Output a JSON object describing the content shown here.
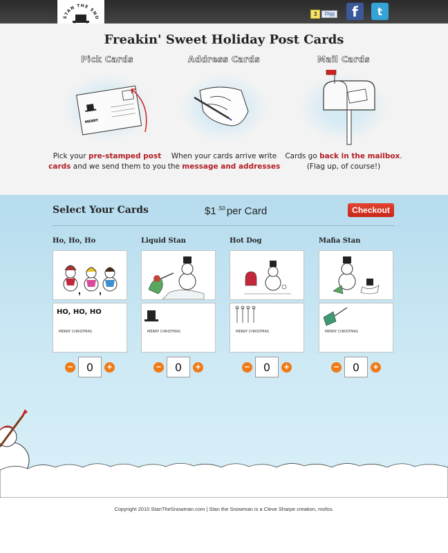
{
  "header": {
    "logo_text": "STAN THE SNOWMAN",
    "digg": {
      "count": "3",
      "label": "Digg"
    },
    "social": [
      {
        "name": "facebook",
        "glyph": "f",
        "color": "#3b5998"
      },
      {
        "name": "twitter",
        "glyph": "t",
        "color": "#33a3d8"
      }
    ]
  },
  "how": {
    "title": "Freakin' Sweet Holiday Post Cards",
    "steps": [
      {
        "heading": "Pick Cards",
        "text_pre": "Pick your ",
        "text_hl": "pre-stamped post cards",
        "text_post": " and we send them to you"
      },
      {
        "heading": "Address Cards",
        "text_pre": "When your cards arrive write the ",
        "text_hl": "message and addresses",
        "text_post": ""
      },
      {
        "heading": "Mail Cards",
        "text_pre": "Cards go ",
        "text_hl": "back in the mailbox",
        "text_post": ". (Flag up, of course!)"
      }
    ]
  },
  "shop": {
    "title": "Select Your Cards",
    "price_dollars": "$1",
    "price_cents": ".50",
    "price_suffix": "per Card",
    "checkout_label": "Checkout",
    "cards": [
      {
        "name": "Ho, Ho, Ho",
        "back_text": "HO, HO, HO",
        "quantity": "0"
      },
      {
        "name": "Liquid Stan",
        "back_text": "",
        "quantity": "0"
      },
      {
        "name": "Hot Dog",
        "back_text": "",
        "quantity": "0"
      },
      {
        "name": "Mafia Stan",
        "back_text": "",
        "quantity": "0"
      }
    ],
    "back_greeting": "MERRY CHRISTMAS",
    "minus_glyph": "−",
    "plus_glyph": "+"
  },
  "footer": {
    "text": "Copyright 2010 StanTheSnowman.com | Stan the Snowman is a Cleve Sharpe creation, mofos."
  },
  "colors": {
    "accent_red": "#b21e24",
    "checkout": "#d6301f",
    "qty_button": "#f07a15",
    "sky": "#c4e5f2"
  }
}
